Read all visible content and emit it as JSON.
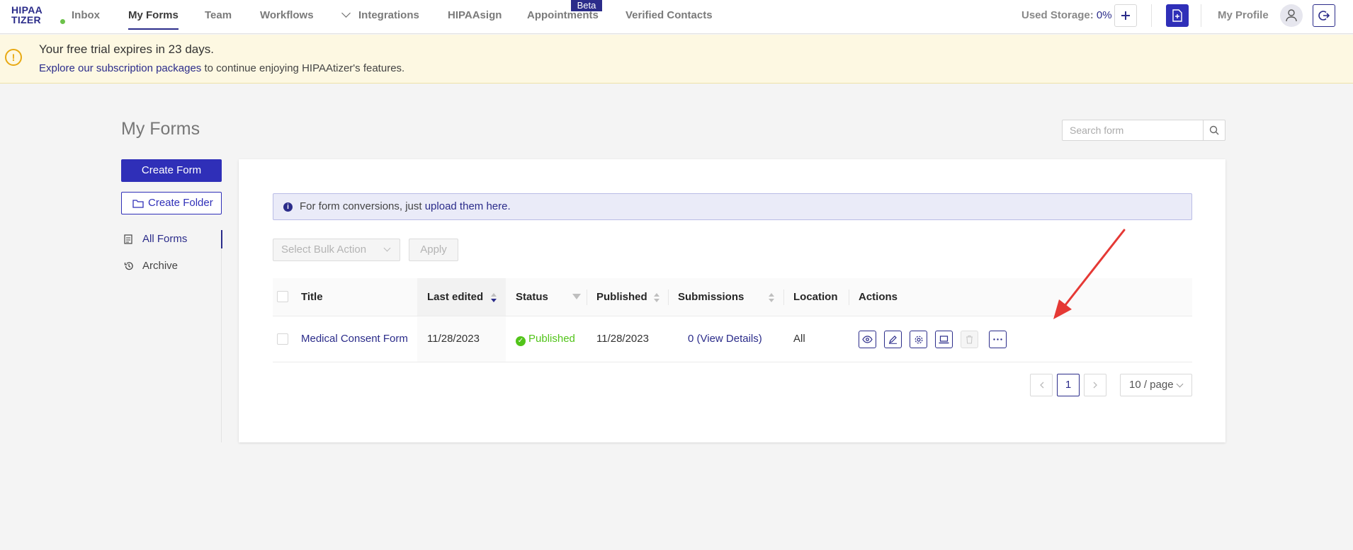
{
  "nav": {
    "logo_line1": "HIPAA",
    "logo_line2": "TIZER",
    "items": [
      "Inbox",
      "My Forms",
      "Team",
      "Workflows",
      "Integrations",
      "HIPAAsign",
      "Appointments",
      "Verified Contacts"
    ],
    "active_item": "My Forms",
    "beta_badge": "Beta",
    "storage_label": "Used Storage:",
    "storage_value": "0%",
    "profile_label": "My Profile"
  },
  "banner": {
    "title": "Your free trial expires in 23 days.",
    "link_text": "Explore our subscription packages",
    "rest_text": " to continue enjoying HIPAAtizer's features."
  },
  "page": {
    "title": "My Forms",
    "create_form": "Create Form",
    "create_folder": "Create Folder",
    "sidebar": [
      {
        "label": "All Forms",
        "active": true
      },
      {
        "label": "Archive",
        "active": false
      }
    ],
    "search_placeholder": "Search form"
  },
  "info": {
    "text": "For form conversions, just ",
    "link": "upload them here."
  },
  "bulk": {
    "placeholder": "Select Bulk Action",
    "apply": "Apply"
  },
  "table": {
    "columns": [
      "Title",
      "Last edited",
      "Status",
      "Published",
      "Submissions",
      "Location",
      "Actions"
    ],
    "rows": [
      {
        "title": "Medical Consent Form",
        "last_edited": "11/28/2023",
        "status": "Published",
        "published": "11/28/2023",
        "submissions": "0 (View Details)",
        "location": "All"
      }
    ]
  },
  "pagination": {
    "current_page": "1",
    "page_size": "10 / page"
  },
  "colors": {
    "brand": "#2b2c8a",
    "primary_button": "#2f2fb8",
    "success": "#52c41a",
    "warning": "#e8a912",
    "annotation_arrow": "#e53935"
  }
}
